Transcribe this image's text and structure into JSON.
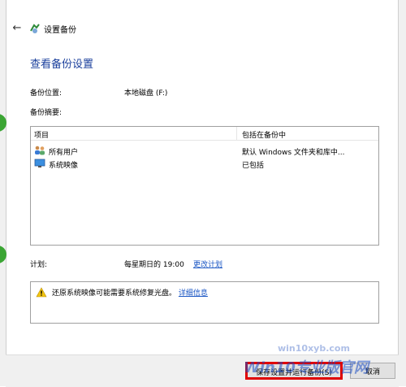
{
  "header": {
    "back_icon": "arrow-left-icon",
    "app_icon": "backup-icon",
    "title": "设置备份"
  },
  "section_title": "查看备份设置",
  "backup_location": {
    "label": "备份位置:",
    "value": "本地磁盘 (F:)"
  },
  "backup_summary": {
    "label": "备份摘要:"
  },
  "table": {
    "columns": [
      "项目",
      "包括在备份中"
    ],
    "rows": [
      {
        "icon": "users-icon",
        "item": "所有用户",
        "included": "默认 Windows 文件夹和库中..."
      },
      {
        "icon": "monitor-icon",
        "item": "系统映像",
        "included": "已包括"
      }
    ]
  },
  "schedule": {
    "label": "计划:",
    "value": "每星期日的 19:00",
    "change_link": "更改计划"
  },
  "warning": {
    "icon": "warning-icon",
    "text": "还原系统映像可能需要系统修复光盘。",
    "link": "详细信息"
  },
  "buttons": {
    "save": "保存设置并运行备份(S)",
    "cancel": "取消"
  },
  "watermark": {
    "url": "win10xyb.com",
    "text": "Win10专业版官网"
  },
  "colors": {
    "title": "#1a3f9c",
    "link": "#1a56c4",
    "highlight": "#e00000"
  }
}
